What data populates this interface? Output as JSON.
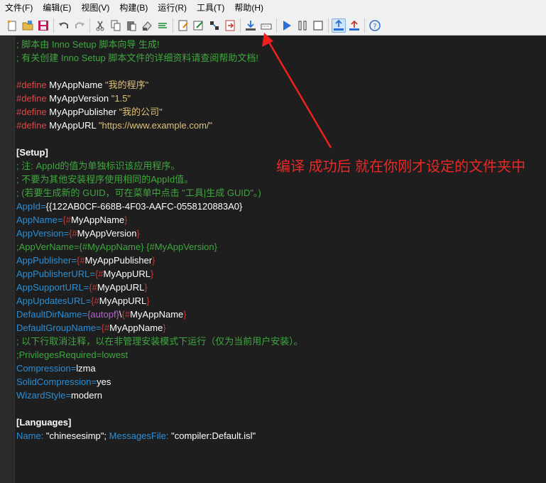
{
  "menu": [
    "文件(F)",
    "编辑(E)",
    "视图(V)",
    "构建(B)",
    "运行(R)",
    "工具(T)",
    "帮助(H)"
  ],
  "toolbar": {
    "icons": [
      "new-icon",
      "open-icon",
      "save-icon",
      "undo-icon",
      "redo-icon",
      "cut-icon",
      "copy-icon",
      "paste-icon",
      "clear-icon",
      "wordwrap-icon",
      "notes-icon",
      "wizard-icon",
      "tools-icon",
      "exit-icon",
      "compile-icon",
      "output-icon",
      "run-icon",
      "pause-icon",
      "stop-icon",
      "upload-icon",
      "export-icon",
      "help-icon"
    ]
  },
  "code": {
    "l1": "; 脚本由 Inno Setup 脚本向导 生成!",
    "l2": "; 有关创建 Inno Setup 脚本文件的详细资料请查阅帮助文档!",
    "define_kw": "#define",
    "d1_name": "MyAppName",
    "d1_val": "\"我的程序\"",
    "d2_name": "MyAppVersion",
    "d2_val": "\"1.5\"",
    "d3_name": "MyAppPublisher",
    "d3_val": "\"我的公司\"",
    "d4_name": "MyAppURL",
    "d4_val": "\"https://www.example.com/\"",
    "setup_header": "[Setup]",
    "note1": "; 注: AppId的值为单独标识该应用程序。",
    "note2": "; 不要为其他安装程序使用相同的AppId值。",
    "note3": "; (若要生成新的 GUID，可在菜单中点击 \"工具|生成 GUID\"。)",
    "appid_key": "AppId",
    "appid_val": "{{122AB0CF-668B-4F03-AAFC-0558120883A0}",
    "appname_key": "AppName",
    "appversion_key": "AppVersion",
    "appvername_comment": ";AppVerName={#MyAppName} {#MyAppVersion}",
    "apppublisher_key": "AppPublisher",
    "apppublisherurl_key": "AppPublisherURL",
    "appsupporturl_key": "AppSupportURL",
    "appupdatesurl_key": "AppUpdatesURL",
    "defaultdirname_key": "DefaultDirName",
    "autopf": "autopf",
    "defaultgroupname_key": "DefaultGroupName",
    "note4": "; 以下行取消注释，以在非管理安装模式下运行（仅为当前用户安装）。",
    "privileges_comment": ";PrivilegesRequired=lowest",
    "compression_key": "Compression",
    "compression_val": "lzma",
    "solid_key": "SolidCompression",
    "solid_val": "yes",
    "wizard_key": "WizardStyle",
    "wizard_val": "modern",
    "lang_header": "[Languages]",
    "name_key": "Name:",
    "name_val": "\"chinesesimp\";",
    "msg_key": "MessagesFile:",
    "msg_val": "\"compiler:Default.isl\"",
    "v_appname": "MyAppName",
    "v_appversion": "MyAppVersion",
    "v_apppublisher": "MyAppPublisher",
    "v_appurl": "MyAppURL"
  },
  "annotation": "编译 成功后 就在你刚才设定的文件夹中",
  "colors": {
    "annotation": "#e62a2a",
    "comment": "#3fa73f",
    "key": "#2a8fd6",
    "define": "#e04646",
    "string": "#ddc07a"
  }
}
